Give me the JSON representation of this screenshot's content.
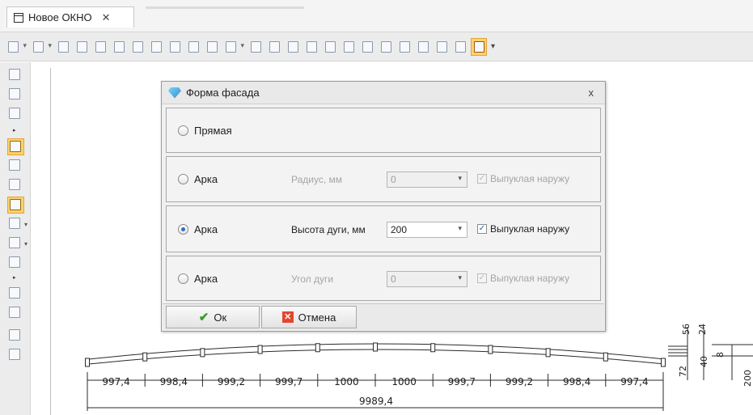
{
  "tab": {
    "title": "Новое ОКНО",
    "close_glyph": "✕"
  },
  "dialog": {
    "title": "Форма фасада",
    "close_glyph": "x",
    "options": [
      {
        "label": "Прямая",
        "selected": false
      },
      {
        "label": "Арка",
        "selected": false,
        "field_label": "Радиус, мм",
        "value": "0",
        "checkbox_label": "Выпуклая наружу",
        "checked": true,
        "enabled": false
      },
      {
        "label": "Арка",
        "selected": true,
        "field_label": "Высота дуги, мм",
        "value": "200",
        "checkbox_label": "Выпуклая наружу",
        "checked": true,
        "enabled": true
      },
      {
        "label": "Арка",
        "selected": false,
        "field_label": "Угол дуги",
        "value": "0",
        "checkbox_label": "Выпуклая наружу",
        "checked": true,
        "enabled": false
      }
    ],
    "ok_label": "Ок",
    "cancel_label": "Отмена"
  },
  "drawing": {
    "segment_widths": [
      "997,4",
      "998,4",
      "999,2",
      "999,7",
      "1000",
      "1000",
      "999,7",
      "999,2",
      "998,4",
      "997,4"
    ],
    "total_width": "9989,4",
    "profile_dims": [
      "56",
      "24",
      "72",
      "40",
      "8",
      "200"
    ]
  },
  "colors": {
    "accent": "#ffd26b",
    "selection": "#2f6fc3",
    "ok_icon": "#3a9b2c",
    "cancel_icon": "#e2462e"
  }
}
